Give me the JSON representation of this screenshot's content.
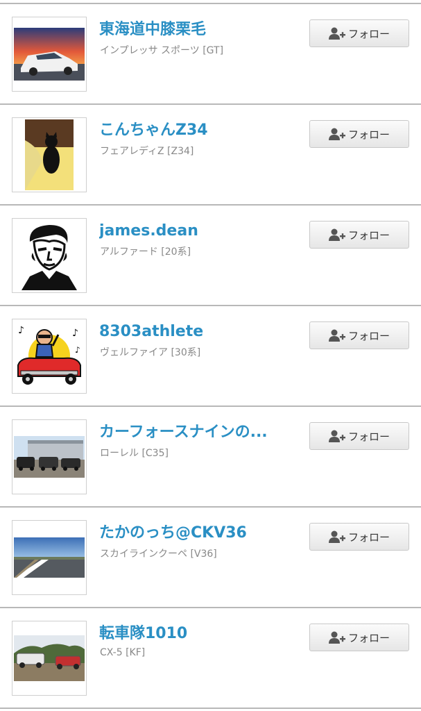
{
  "follow_label": "フォロー",
  "users": [
    {
      "name": "東海道中膝栗毛",
      "car": "インプレッサ スポーツ [GT]",
      "thumb": "sunset-car-photo"
    },
    {
      "name": "こんちゃんZ34",
      "car": "フェアレディZ [Z34]",
      "thumb": "black-cat-photo"
    },
    {
      "name": "james.dean",
      "car": "アルファード [20系]",
      "thumb": "portrait-stencil"
    },
    {
      "name": "8303athlete",
      "car": "ヴェルファイア [30系]",
      "thumb": "cartoon-cadillac"
    },
    {
      "name": "カーフォースナインの...",
      "car": "ローレル [C35]",
      "thumb": "car-lot-photo"
    },
    {
      "name": "たかのっち@CKV36",
      "car": "スカイラインクーペ [V36]",
      "thumb": "track-photo"
    },
    {
      "name": "転車隊1010",
      "car": "CX-5 [KF]",
      "thumb": "offroad-cars-photo"
    }
  ],
  "colors": {
    "name": "#2a8fc4",
    "sub": "#888888",
    "divider": "#b8b8b8"
  }
}
